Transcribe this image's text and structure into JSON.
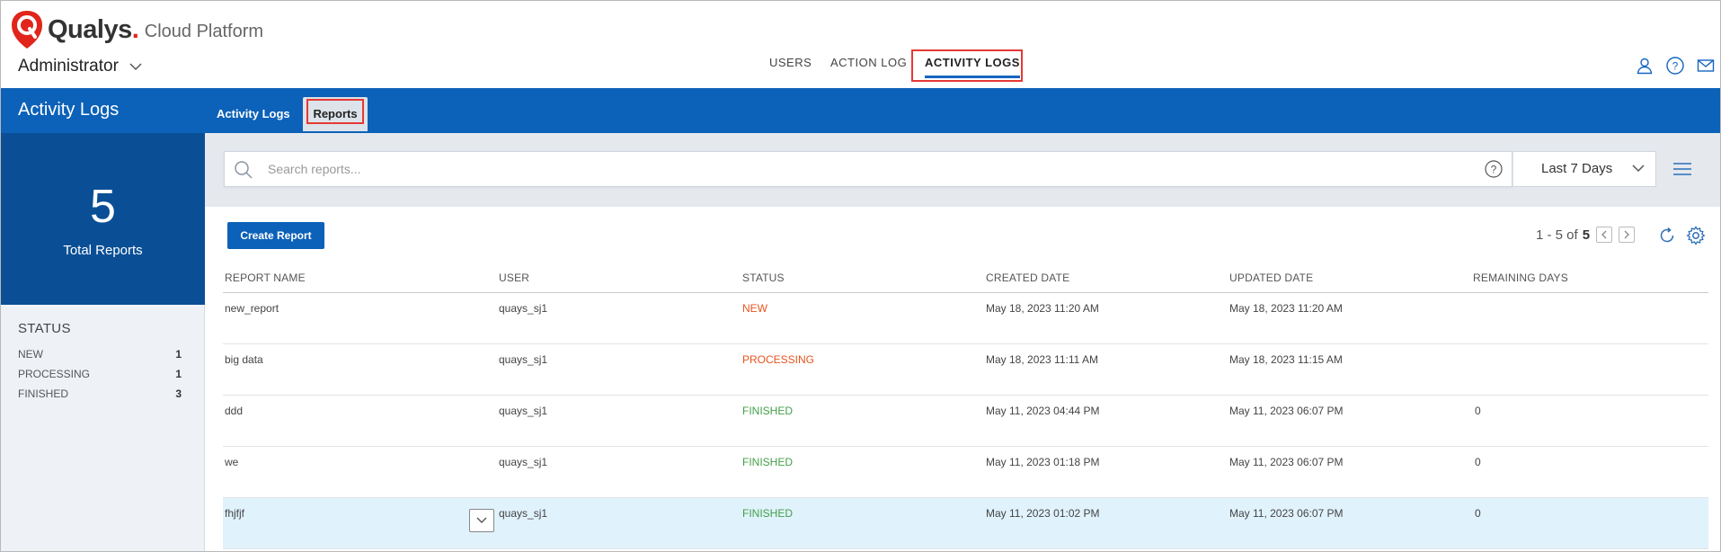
{
  "brand": {
    "name": "Qualys",
    "dot": ".",
    "product": "Cloud Platform"
  },
  "header": {
    "role": "Administrator",
    "nav": [
      {
        "label": "USERS"
      },
      {
        "label": "ACTION LOG"
      },
      {
        "label": "ACTIVITY LOGS"
      }
    ],
    "icons": [
      "user-icon",
      "help-icon",
      "mail-icon"
    ]
  },
  "page": {
    "title": "Activity Logs",
    "tabs": [
      {
        "label": "Activity Logs"
      },
      {
        "label": "Reports"
      }
    ]
  },
  "summary": {
    "count": "5",
    "label": "Total Reports"
  },
  "filters": {
    "heading": "STATUS",
    "items": [
      {
        "label": "NEW",
        "count": "1"
      },
      {
        "label": "PROCESSING",
        "count": "1"
      },
      {
        "label": "FINISHED",
        "count": "3"
      }
    ]
  },
  "search": {
    "placeholder": "Search reports...",
    "range": "Last 7 Days"
  },
  "toolbar": {
    "create_label": "Create Report",
    "pager_range": "1 - 5 of",
    "pager_total": "5"
  },
  "table": {
    "columns": [
      "REPORT NAME",
      "USER",
      "STATUS",
      "CREATED DATE",
      "UPDATED DATE",
      "REMAINING DAYS"
    ],
    "rows": [
      {
        "name": "new_report",
        "user": "quays_sj1",
        "status": "NEW",
        "created": "May 18, 2023 11:20 AM",
        "updated": "May 18, 2023 11:20 AM",
        "remaining": ""
      },
      {
        "name": "big data",
        "user": "quays_sj1",
        "status": "PROCESSING",
        "created": "May 18, 2023 11:11 AM",
        "updated": "May 18, 2023 11:15 AM",
        "remaining": ""
      },
      {
        "name": "ddd",
        "user": "quays_sj1",
        "status": "FINISHED",
        "created": "May 11, 2023 04:44 PM",
        "updated": "May 11, 2023 06:07 PM",
        "remaining": "0"
      },
      {
        "name": "we",
        "user": "quays_sj1",
        "status": "FINISHED",
        "created": "May 11, 2023 01:18 PM",
        "updated": "May 11, 2023 06:07 PM",
        "remaining": "0"
      },
      {
        "name": "fhjfjf",
        "user": "quays_sj1",
        "status": "FINISHED",
        "created": "May 11, 2023 01:02 PM",
        "updated": "May 11, 2023 06:07 PM",
        "remaining": "0"
      }
    ]
  },
  "colors": {
    "brand_blue": "#0c61b8",
    "dark_blue": "#0a4f96",
    "logo_red": "#e1251b",
    "new": "#e8541e",
    "finished": "#43a047",
    "highlight": "#e53935"
  }
}
